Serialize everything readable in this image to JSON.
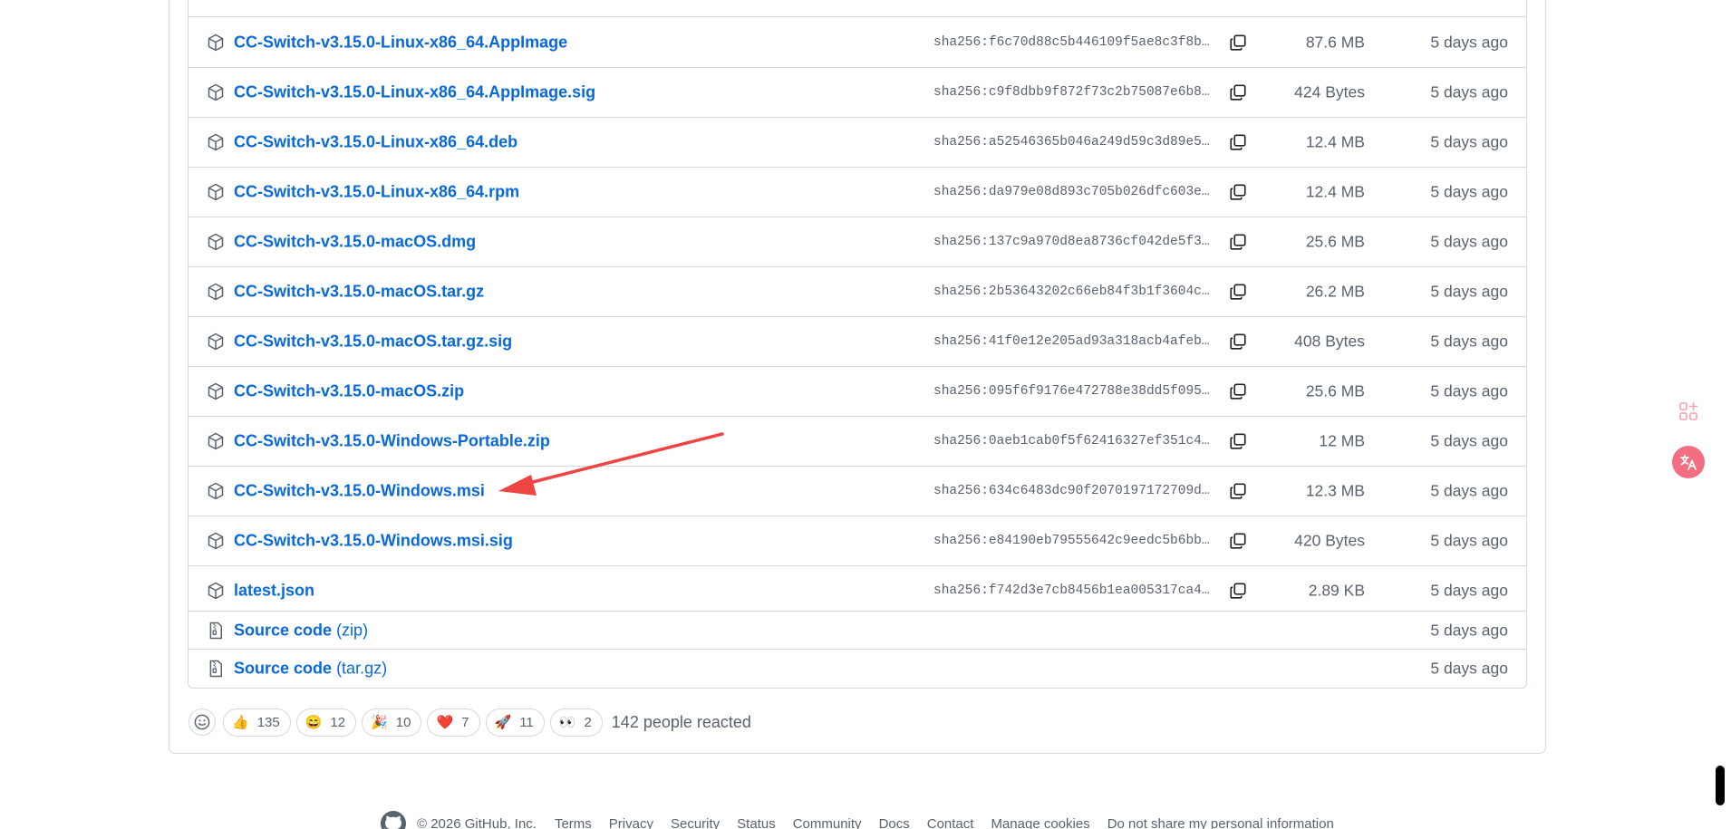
{
  "assets": [
    {
      "name": "CC-Switch-v3.15.0-Linux-x86_64.AppImage",
      "sha": "sha256:f6c70d88c5b446109f5ae8c3f8b3a…",
      "size": "87.6 MB",
      "date": "5 days ago"
    },
    {
      "name": "CC-Switch-v3.15.0-Linux-x86_64.AppImage.sig",
      "sha": "sha256:c9f8dbb9f872f73c2b75087e6b8a6…",
      "size": "424 Bytes",
      "date": "5 days ago"
    },
    {
      "name": "CC-Switch-v3.15.0-Linux-x86_64.deb",
      "sha": "sha256:a52546365b046a249d59c3d89e55f…",
      "size": "12.4 MB",
      "date": "5 days ago"
    },
    {
      "name": "CC-Switch-v3.15.0-Linux-x86_64.rpm",
      "sha": "sha256:da979e08d893c705b026dfc603eba…",
      "size": "12.4 MB",
      "date": "5 days ago"
    },
    {
      "name": "CC-Switch-v3.15.0-macOS.dmg",
      "sha": "sha256:137c9a970d8ea8736cf042de5f368…",
      "size": "25.6 MB",
      "date": "5 days ago"
    },
    {
      "name": "CC-Switch-v3.15.0-macOS.tar.gz",
      "sha": "sha256:2b53643202c66eb84f3b1f3604c64…",
      "size": "26.2 MB",
      "date": "5 days ago"
    },
    {
      "name": "CC-Switch-v3.15.0-macOS.tar.gz.sig",
      "sha": "sha256:41f0e12e205ad93a318acb4afeb82…",
      "size": "408 Bytes",
      "date": "5 days ago"
    },
    {
      "name": "CC-Switch-v3.15.0-macOS.zip",
      "sha": "sha256:095f6f9176e472788e38dd5f09502…",
      "size": "25.6 MB",
      "date": "5 days ago"
    },
    {
      "name": "CC-Switch-v3.15.0-Windows-Portable.zip",
      "sha": "sha256:0aeb1cab0f5f62416327ef351c48a…",
      "size": "12 MB",
      "date": "5 days ago"
    },
    {
      "name": "CC-Switch-v3.15.0-Windows.msi",
      "sha": "sha256:634c6483dc90f2070197172709dd6…",
      "size": "12.3 MB",
      "date": "5 days ago"
    },
    {
      "name": "CC-Switch-v3.15.0-Windows.msi.sig",
      "sha": "sha256:e84190eb79555642c9eedc5b6bbff…",
      "size": "420 Bytes",
      "date": "5 days ago"
    },
    {
      "name": "latest.json",
      "sha": "sha256:f742d3e7cb8456b1ea005317ca454…",
      "size": "2.89 KB",
      "date": "5 days ago"
    }
  ],
  "source_code": [
    {
      "label": "Source code",
      "format": "(zip)",
      "date": "5 days ago"
    },
    {
      "label": "Source code",
      "format": "(tar.gz)",
      "date": "5 days ago"
    }
  ],
  "reactions": [
    {
      "emoji": "👍",
      "count": "135"
    },
    {
      "emoji": "😄",
      "count": "12"
    },
    {
      "emoji": "🎉",
      "count": "10"
    },
    {
      "emoji": "❤️",
      "count": "7"
    },
    {
      "emoji": "🚀",
      "count": "11"
    },
    {
      "emoji": "👀",
      "count": "2"
    }
  ],
  "reacted_text": "142 people reacted",
  "footer": {
    "copyright": "© 2026 GitHub, Inc.",
    "links": [
      "Terms",
      "Privacy",
      "Security",
      "Status",
      "Community",
      "Docs",
      "Contact",
      "Manage cookies",
      "Do not share my personal information"
    ]
  },
  "icons": {
    "asset": "package-icon",
    "source": "file-zip-icon",
    "copy": "copy-icon",
    "add_reaction": "smiley-icon",
    "side_tool_1": "apps-add-icon",
    "side_tool_2": "translate-icon",
    "footer_logo": "github-logo-icon"
  },
  "colors": {
    "link": "#0969da",
    "muted": "#59636e",
    "border": "#d1d9e0",
    "annotation_arrow": "#ef4444",
    "side_tool_accent": "#f26f82"
  }
}
